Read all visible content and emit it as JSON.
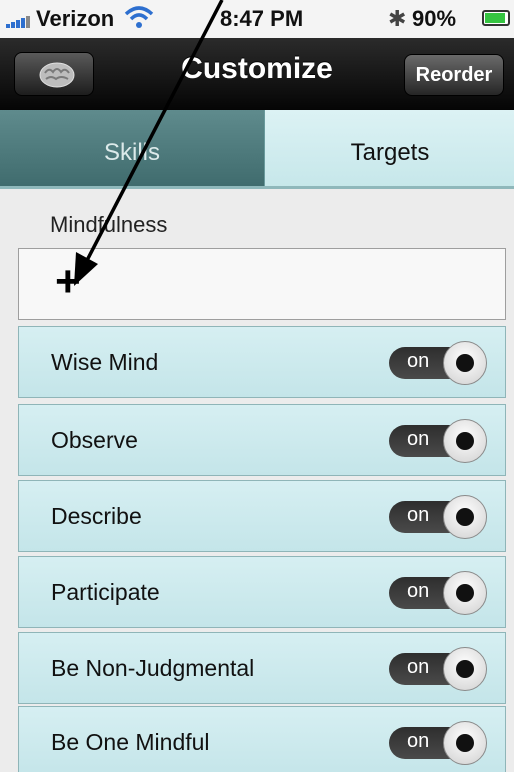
{
  "status_bar": {
    "carrier": "Verizon",
    "time": "8:47 PM",
    "bluetooth_symbol": "✱",
    "battery_percent": "90%",
    "battery_level": 0.9,
    "icons": [
      "signal-bars-icon",
      "wifi-icon",
      "bluetooth-icon",
      "battery-icon"
    ]
  },
  "nav": {
    "title": "Customize",
    "back_icon": "brain-icon",
    "reorder_label": "Reorder"
  },
  "tabs": [
    {
      "label": "Skills",
      "selected": true
    },
    {
      "label": "Targets",
      "selected": false
    }
  ],
  "section": {
    "title": "Mindfulness",
    "add_label": "+"
  },
  "skills": [
    {
      "label": "Wise Mind",
      "state": "on"
    },
    {
      "label": "Observe",
      "state": "on"
    },
    {
      "label": "Describe",
      "state": "on"
    },
    {
      "label": "Participate",
      "state": "on"
    },
    {
      "label": "Be Non-Judgmental",
      "state": "on"
    },
    {
      "label": "Be One Mindful",
      "state": "on"
    }
  ],
  "colors": {
    "tab_selected": "#4f7b7d",
    "tab_unselected": "#d2eef1",
    "row_background": "#cdeaee",
    "navbar": "#141414",
    "battery_fill": "#35c441",
    "signal": "#2d6fcf"
  },
  "annotation": "arrow-pointing-to-add-button"
}
